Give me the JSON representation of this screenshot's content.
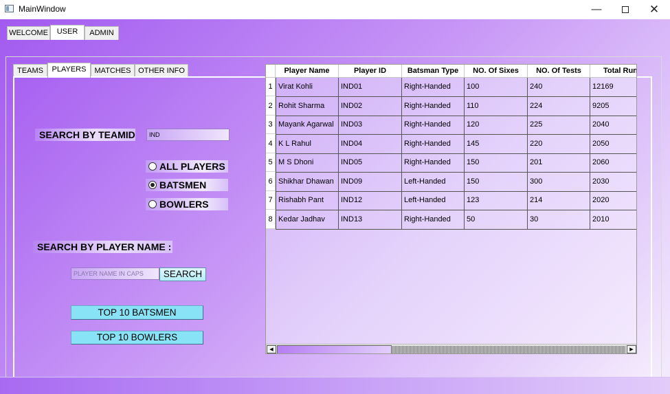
{
  "window": {
    "title": "MainWindow",
    "minimize_glyph": "—",
    "close_glyph": "✕"
  },
  "main_tabs": [
    {
      "label": "WELCOME",
      "active": false
    },
    {
      "label": "USER",
      "active": true
    },
    {
      "label": "ADMIN",
      "active": false
    }
  ],
  "sub_tabs": [
    {
      "label": "TEAMS",
      "active": false
    },
    {
      "label": "PLAYERS",
      "active": true
    },
    {
      "label": "MATCHES",
      "active": false
    },
    {
      "label": "OTHER INFO",
      "active": false
    }
  ],
  "search_team": {
    "label": "SEARCH BY TEAMID",
    "value": "IND"
  },
  "filter": {
    "options": [
      {
        "label": "ALL PLAYERS",
        "checked": false
      },
      {
        "label": "BATSMEN",
        "checked": true
      },
      {
        "label": "BOWLERS",
        "checked": false
      }
    ]
  },
  "search_player": {
    "label": "SEARCH BY PLAYER NAME :",
    "placeholder": "PLAYER NAME IN CAPS",
    "button": "SEARCH"
  },
  "buttons": {
    "top_batsmen": "TOP 10 BATSMEN",
    "top_bowlers": "TOP 10 BOWLERS"
  },
  "table": {
    "columns": [
      "Player Name",
      "Player ID",
      "Batsman Type",
      "NO. Of Sixes",
      "NO. Of Tests",
      "Total Runs"
    ],
    "rows": [
      {
        "num": "1",
        "cells": [
          "Virat Kohli",
          "IND01",
          "Right-Handed",
          "100",
          "240",
          "12169"
        ]
      },
      {
        "num": "2",
        "cells": [
          "Rohit Sharma",
          "IND02",
          "Right-Handed",
          "110",
          "224",
          "9205"
        ]
      },
      {
        "num": "3",
        "cells": [
          "Mayank Agarwal",
          "IND03",
          "Right-Handed",
          "120",
          "225",
          "2040"
        ]
      },
      {
        "num": "4",
        "cells": [
          "K L Rahul",
          "IND04",
          "Right-Handed",
          "145",
          "220",
          "2050"
        ]
      },
      {
        "num": "5",
        "cells": [
          "M S Dhoni",
          "IND05",
          "Right-Handed",
          "150",
          "201",
          "2060"
        ]
      },
      {
        "num": "6",
        "cells": [
          "Shikhar Dhawan",
          "IND09",
          "Left-Handed",
          "150",
          "300",
          "2030"
        ]
      },
      {
        "num": "7",
        "cells": [
          "Rishabh Pant",
          "IND12",
          "Left-Handed",
          "123",
          "214",
          "2020"
        ]
      },
      {
        "num": "8",
        "cells": [
          "Kedar Jadhav",
          "IND13",
          "Right-Handed",
          "50",
          "30",
          "2010"
        ]
      }
    ],
    "scroll": {
      "left_glyph": "◀",
      "right_glyph": "▶"
    }
  }
}
